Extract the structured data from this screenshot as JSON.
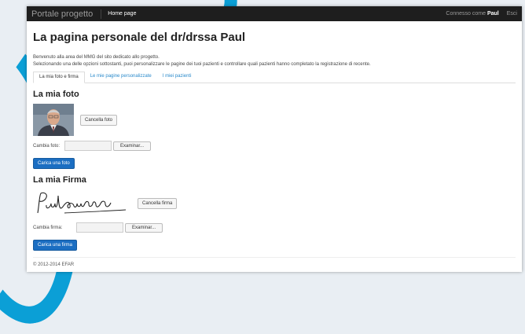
{
  "navbar": {
    "brand": "Portale progetto",
    "home": "Home page",
    "connected_prefix": "Connesso come",
    "connected_user": "Paul",
    "exit": "Esci"
  },
  "page_title": "La pagina personale del dr/drssa Paul",
  "intro": [
    "Benvenuto alla area del MMG del sito dedicato allo progetto.",
    "Selezionando una delle opzioni sottostanti, puoi personalizzare le pagine dei tuoi pazienti e controllare quali pazienti hanno completato la registrazione di recente."
  ],
  "tabs": [
    {
      "label": "La mia foto e firma",
      "active": true
    },
    {
      "label": "Le mie pagine personalizzate",
      "active": false
    },
    {
      "label": "I miei pazienti",
      "active": false
    }
  ],
  "photo_section": {
    "title": "La mia foto",
    "delete_button": "Cancella foto",
    "change_label": "Cambia foto:",
    "browse_button": "Examinar...",
    "upload_button": "Carica una foto"
  },
  "signature_section": {
    "title": "La mia Firma",
    "delete_button": "Cancella firma",
    "change_label": "Cambia firma:",
    "browse_button": "Examinar...",
    "upload_button": "Carica una firma"
  },
  "footer": "© 2012-2014 EFAR",
  "colors": {
    "accent": "#0b9fd6",
    "primary_button": "#1b6ec2",
    "navbar": "#1e1e1e",
    "link": "#2a8acb"
  }
}
